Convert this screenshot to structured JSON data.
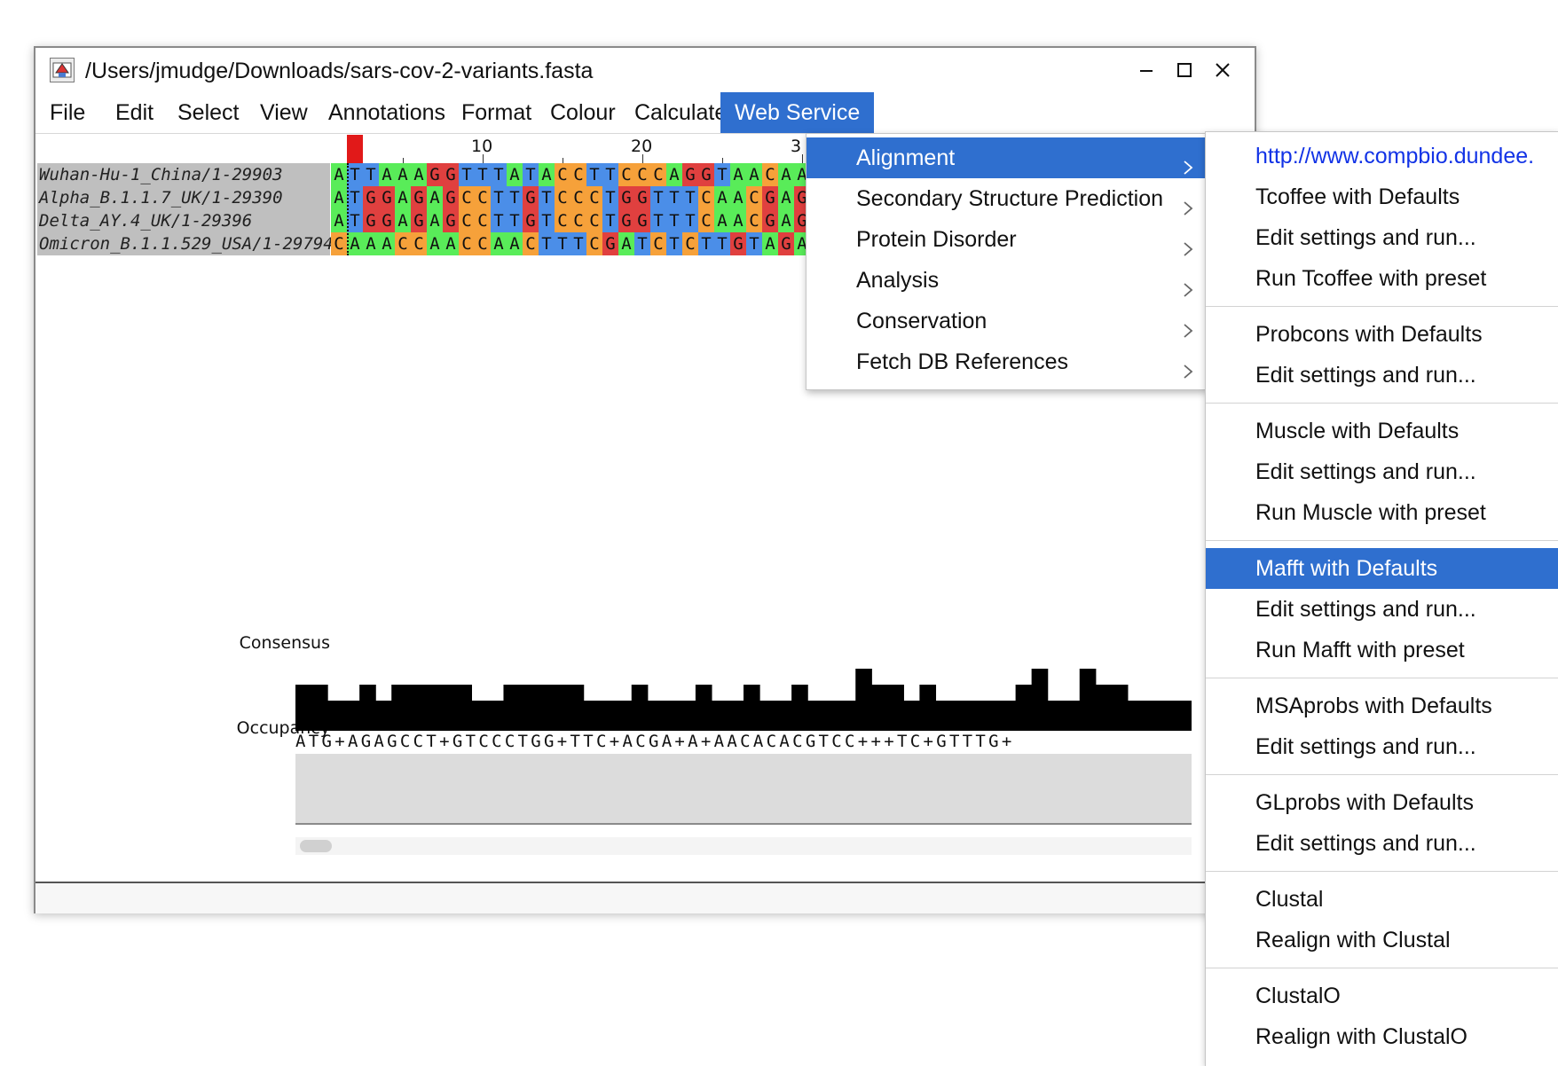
{
  "window": {
    "title": "/Users/jmudge/Downloads/sars-cov-2-variants.fasta",
    "controls": [
      "minimize",
      "maximize",
      "close"
    ]
  },
  "menubar": {
    "items": [
      "File",
      "Edit",
      "Select",
      "View",
      "Annotations",
      "Format",
      "Colour",
      "Calculate",
      "Web Service"
    ],
    "active": "Web Service"
  },
  "ruler": {
    "labels": [
      "10",
      "20",
      "3"
    ]
  },
  "sequences": [
    {
      "name": "Wuhan-Hu-1_China/1-29903",
      "bases": "ATTAAAGGTTTATACCTTCCCAGGTAACAA"
    },
    {
      "name": "Alpha_B.1.1.7_UK/1-29390",
      "bases": "ATGGAGAGCCTTGTCCCTGGTTTCAACGAG"
    },
    {
      "name": "Delta_AY.4_UK/1-29396",
      "bases": "ATGGAGAGCCTTGTCCCTGGTTTCAACGAG"
    },
    {
      "name": "Omicron_B.1.1.529_USA/1-29794",
      "bases": "CAAACCAACCAACTTTCGATCTCTTGTAGA"
    }
  ],
  "annotations": {
    "consensus_label": "Consensus",
    "consensus_sequence": "ATG+AGAGCCT+GTCCCTGG+TTC+ACGA+A+AACACACGTCC+++TC+GTTTG+",
    "occupancy_label": "Occupancy"
  },
  "web_service_menu": {
    "items": [
      {
        "label": "Alignment",
        "highlighted": true
      },
      {
        "label": "Secondary Structure Prediction",
        "highlighted": false
      },
      {
        "label": "Protein Disorder",
        "highlighted": false
      },
      {
        "label": "Analysis",
        "highlighted": false
      },
      {
        "label": "Conservation",
        "highlighted": false
      },
      {
        "label": "Fetch DB References",
        "highlighted": false
      }
    ]
  },
  "alignment_submenu": {
    "groups": [
      {
        "items": [
          {
            "label": "http://www.compbio.dundee.",
            "link": true
          },
          {
            "label": "Tcoffee  with Defaults"
          },
          {
            "label": "Edit settings and run..."
          },
          {
            "label": "Run Tcoffee  with preset"
          }
        ]
      },
      {
        "items": [
          {
            "label": "Probcons  with Defaults"
          },
          {
            "label": "Edit settings and run..."
          }
        ]
      },
      {
        "items": [
          {
            "label": "Muscle  with Defaults"
          },
          {
            "label": "Edit settings and run..."
          },
          {
            "label": "Run Muscle  with preset"
          }
        ]
      },
      {
        "items": [
          {
            "label": "Mafft  with Defaults",
            "highlighted": true
          },
          {
            "label": "Edit settings and run..."
          },
          {
            "label": "Run Mafft  with preset"
          }
        ]
      },
      {
        "items": [
          {
            "label": "MSAprobs  with Defaults"
          },
          {
            "label": "Edit settings and run..."
          }
        ]
      },
      {
        "items": [
          {
            "label": "GLprobs  with Defaults"
          },
          {
            "label": "Edit settings and run..."
          }
        ]
      },
      {
        "items": [
          {
            "label": "Clustal"
          },
          {
            "label": "Realign with Clustal"
          }
        ]
      },
      {
        "items": [
          {
            "label": "ClustalO"
          },
          {
            "label": "Realign with ClustalO"
          }
        ]
      }
    ]
  },
  "colors": {
    "menu_highlight": "#2f6fcf",
    "base_A": "#59ec59",
    "base_C": "#f6a13a",
    "base_G": "#e0403f",
    "base_T": "#4b8ee8",
    "cursor": "#e11919",
    "link": "#1233e6"
  },
  "consensus_histogram": [
    2,
    2,
    1,
    1,
    2,
    1,
    2,
    2,
    2,
    2,
    2,
    1,
    1,
    2,
    2,
    2,
    2,
    2,
    1,
    1,
    1,
    2,
    1,
    1,
    1,
    2,
    1,
    1,
    2,
    1,
    1,
    2,
    1,
    1,
    1,
    3,
    2,
    2,
    1,
    2,
    1,
    1,
    1,
    1,
    1,
    2,
    3,
    1,
    1,
    3,
    2,
    2,
    1,
    1,
    1,
    1
  ]
}
